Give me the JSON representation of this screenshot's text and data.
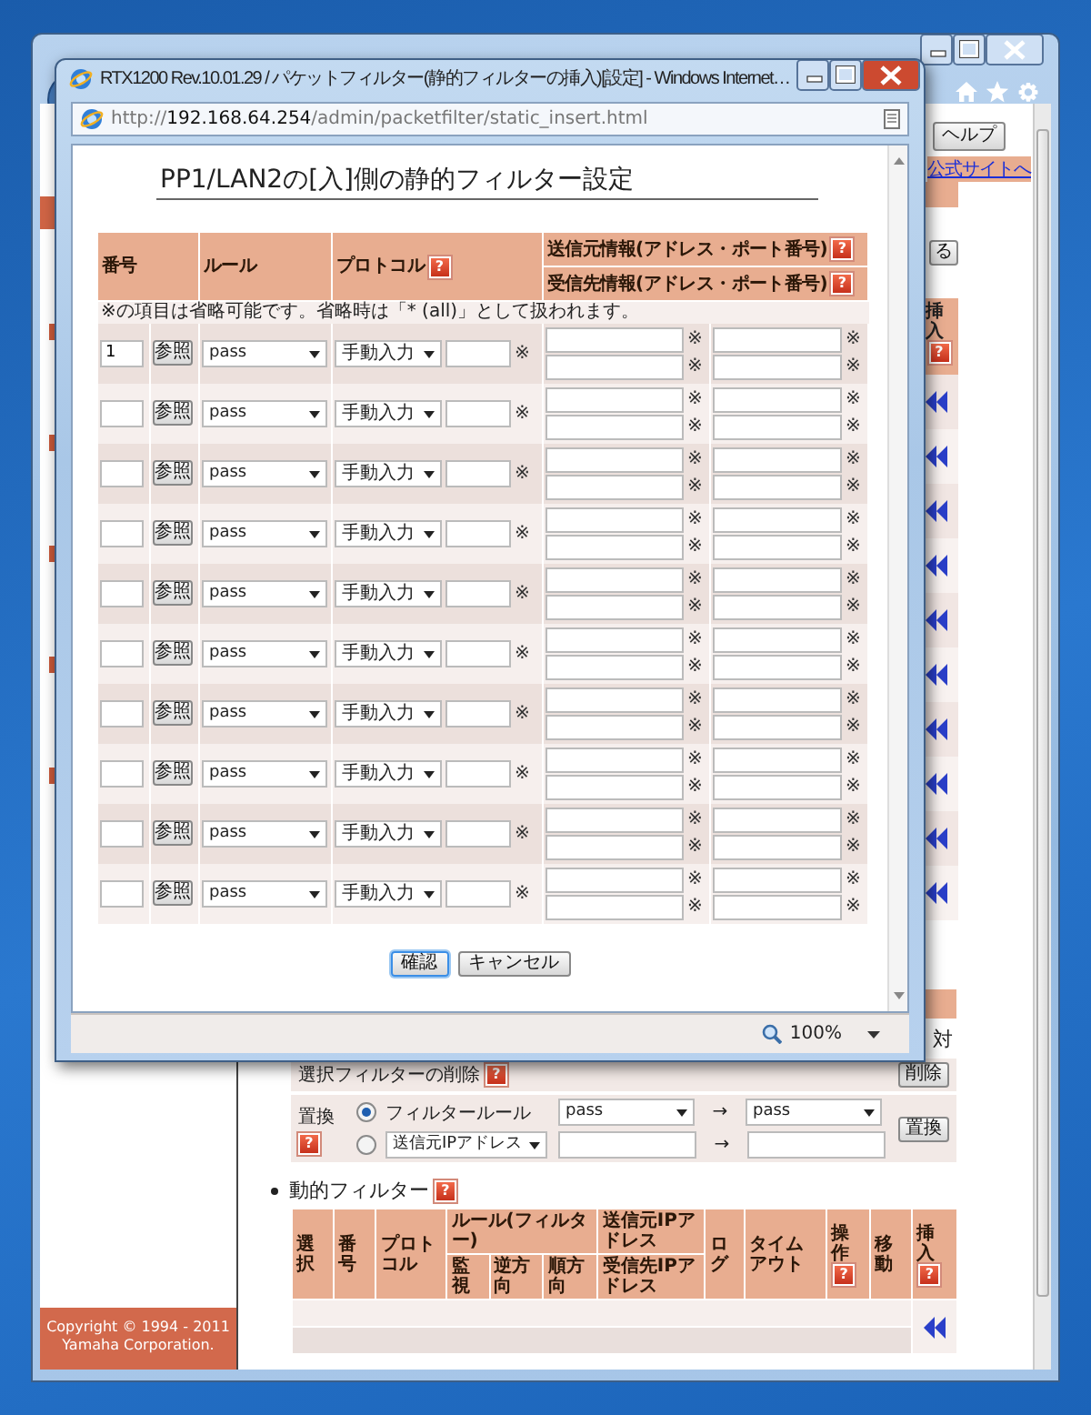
{
  "back_window": {
    "page": {
      "help_button": "ヘルプ",
      "official_site_link": "公式サイトへ",
      "cut_button": "る",
      "insert_header": {
        "label": "挿入",
        "help": "?"
      },
      "cut_label": "対",
      "delete": {
        "label": "選択フィルターの削除",
        "help": "?",
        "button": "削除"
      },
      "replace": {
        "label": "置換",
        "help": "?",
        "button": "置換",
        "options": [
          {
            "kind": "rule",
            "selected": true,
            "label": "フィルタールール",
            "from": "pass",
            "arrow": "→",
            "to": "pass"
          },
          {
            "kind": "address",
            "selected": false,
            "field": "送信元IPアドレス",
            "arrow": "→"
          }
        ]
      },
      "dynamic_filter": {
        "title": "動的フィルター",
        "help": "?",
        "columns": [
          {
            "label": "選択"
          },
          {
            "label": "番号"
          },
          {
            "label": "プロトコル"
          },
          {
            "label": "ルール(フィルター)",
            "children": [
              {
                "label": "監視"
              },
              {
                "label": "逆方向"
              },
              {
                "label": "順方向"
              }
            ]
          },
          {
            "label": "送信元IPアドレス",
            "second": "受信先IPアドレス"
          },
          {
            "label": "ログ"
          },
          {
            "label": "タイムアウト"
          },
          {
            "label": "操作",
            "help": "?"
          },
          {
            "label": "移動"
          },
          {
            "label": "挿入",
            "help": "?"
          }
        ]
      },
      "copyright": [
        "Copyright © 1994 - 2011",
        "Yamaha Corporation."
      ]
    }
  },
  "popup": {
    "title": "RTX1200 Rev.10.01.29 / パケットフィルター(静的フィルターの挿入)[設定] - Windows Internet…",
    "url": {
      "scheme": "http://",
      "host": "192.168.64.254",
      "path": "/admin/packetfilter/static_insert.html"
    },
    "heading": "PP1/LAN2の[入]側の静的フィルター設定",
    "headers": {
      "number": "番号",
      "rule": "ルール",
      "protocol": {
        "label": "プロトコル",
        "help": "?"
      },
      "source": {
        "label": "送信元情報(アドレス・ポート番号)",
        "help": "?"
      },
      "destination": {
        "label": "受信先情報(アドレス・ポート番号)",
        "help": "?"
      }
    },
    "note": "※の項目は省略可能です。省略時は「* (all)」として扱われます。",
    "rows": [
      {
        "number": "1",
        "ref_button": "参照",
        "rule": "pass",
        "protocol": "手動入力",
        "marks": [
          "※",
          "※",
          "※",
          "※",
          "※"
        ]
      },
      {
        "ref_button": "参照",
        "rule": "pass",
        "protocol": "手動入力",
        "marks": [
          "※",
          "※",
          "※",
          "※",
          "※"
        ]
      },
      {
        "ref_button": "参照",
        "rule": "pass",
        "protocol": "手動入力",
        "marks": [
          "※",
          "※",
          "※",
          "※",
          "※"
        ]
      },
      {
        "ref_button": "参照",
        "rule": "pass",
        "protocol": "手動入力",
        "marks": [
          "※",
          "※",
          "※",
          "※",
          "※"
        ]
      },
      {
        "ref_button": "参照",
        "rule": "pass",
        "protocol": "手動入力",
        "marks": [
          "※",
          "※",
          "※",
          "※",
          "※"
        ]
      },
      {
        "ref_button": "参照",
        "rule": "pass",
        "protocol": "手動入力",
        "marks": [
          "※",
          "※",
          "※",
          "※",
          "※"
        ]
      },
      {
        "ref_button": "参照",
        "rule": "pass",
        "protocol": "手動入力",
        "marks": [
          "※",
          "※",
          "※",
          "※",
          "※"
        ]
      },
      {
        "ref_button": "参照",
        "rule": "pass",
        "protocol": "手動入力",
        "marks": [
          "※",
          "※",
          "※",
          "※",
          "※"
        ]
      },
      {
        "ref_button": "参照",
        "rule": "pass",
        "protocol": "手動入力",
        "marks": [
          "※",
          "※",
          "※",
          "※",
          "※"
        ]
      },
      {
        "ref_button": "参照",
        "rule": "pass",
        "protocol": "手動入力",
        "marks": [
          "※",
          "※",
          "※",
          "※",
          "※"
        ]
      }
    ],
    "buttons": [
      {
        "label": "確認",
        "focused": true
      },
      {
        "label": "キャンセル",
        "focused": false
      }
    ],
    "zoom": "100%"
  }
}
